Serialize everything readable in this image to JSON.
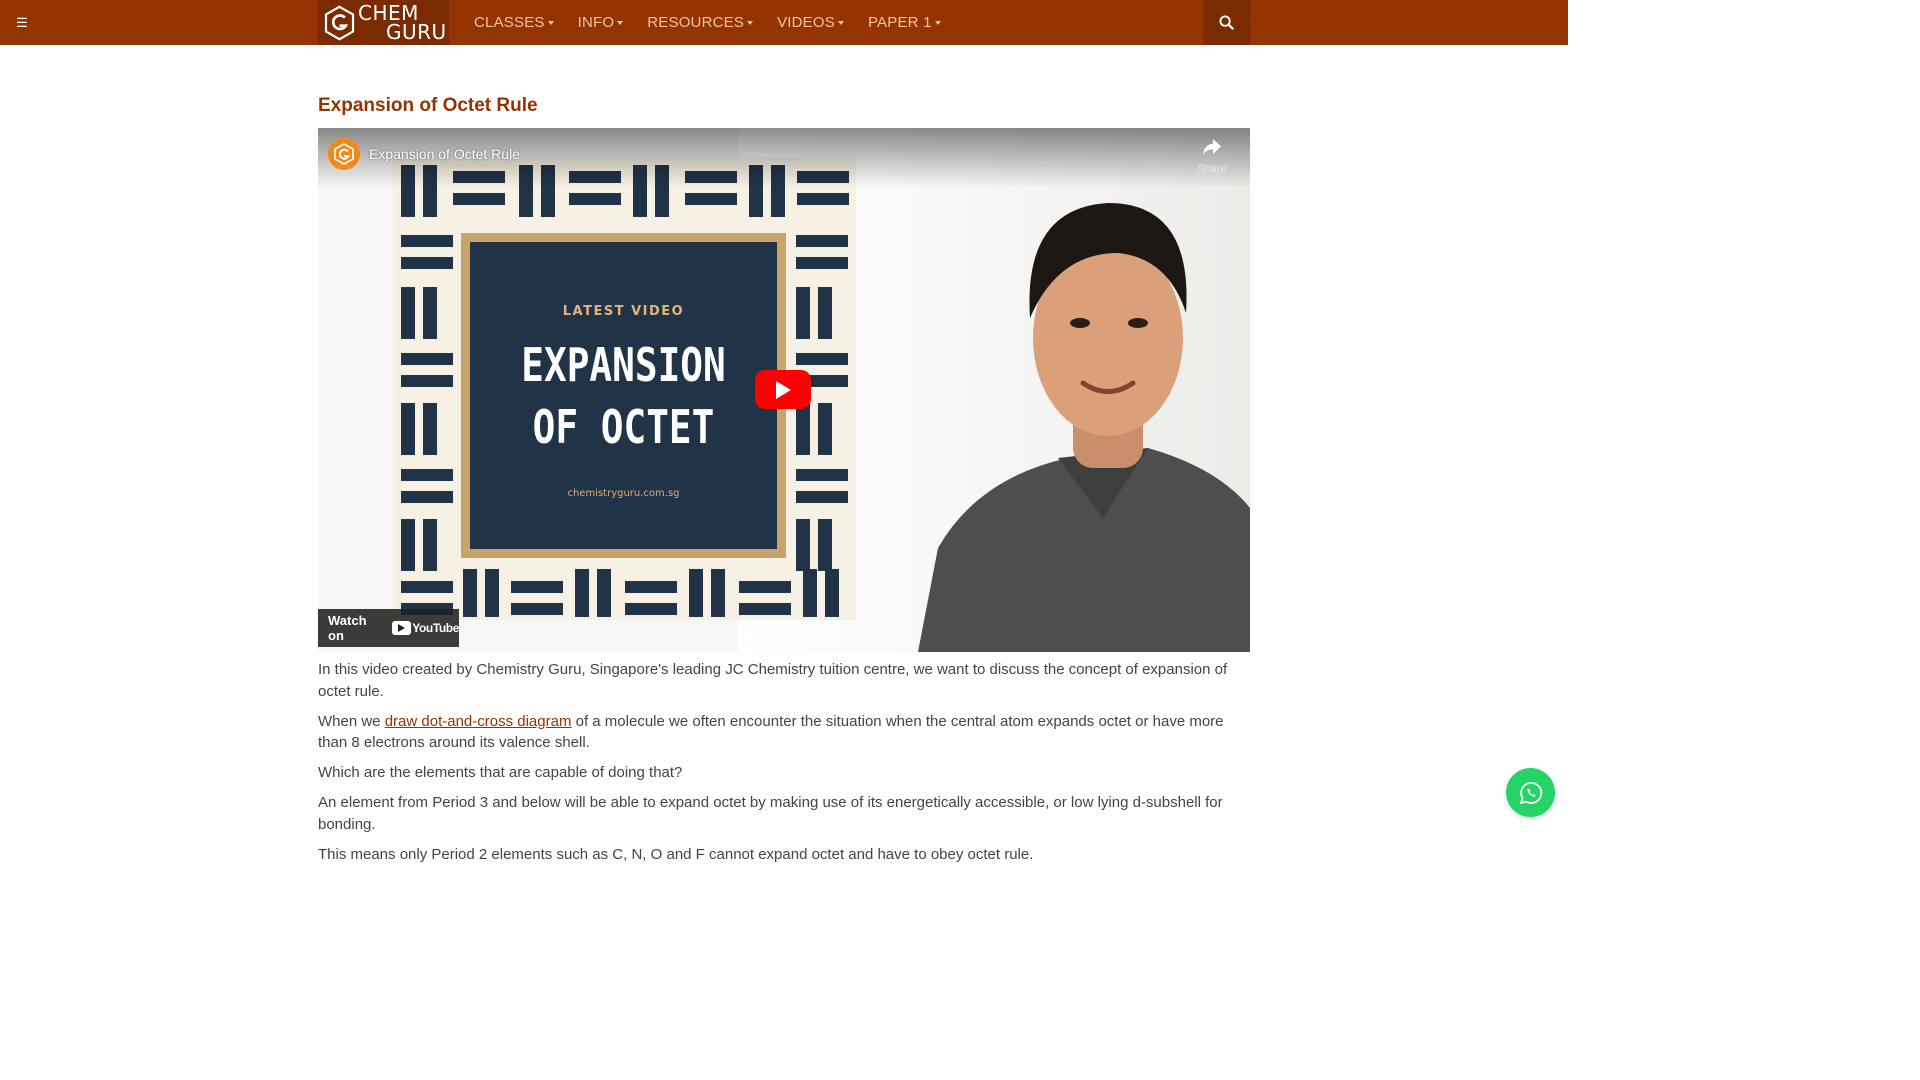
{
  "navbar": {
    "menu_icon": "hamburger-icon",
    "logo_line1": "CHEM",
    "logo_line2": "GURU",
    "items": [
      {
        "label": "CLASSES"
      },
      {
        "label": "INFO"
      },
      {
        "label": "RESOURCES"
      },
      {
        "label": "VIDEOS"
      },
      {
        "label": "PAPER 1"
      }
    ],
    "search_icon": "search-icon",
    "color": "#933402"
  },
  "page": {
    "title": "Expansion of Octet Rule"
  },
  "video": {
    "title": "Expansion of Octet Rule",
    "share_label": "Share",
    "watch_on_label": "Watch on",
    "youtube_label": "YouTube",
    "thumbnail": {
      "kicker": "LATEST VIDEO",
      "headline_line1": "EXPANSION",
      "headline_line2": "OF OCTET",
      "url": "chemistryguru.com.sg"
    },
    "play_color": "#ff0000"
  },
  "article": {
    "p1": "In this video created by Chemistry Guru, Singapore's leading JC Chemistry tuition centre, we want to discuss the concept of expansion of octet rule.",
    "p2_before": "When we ",
    "p2_link": "draw dot-and-cross diagram",
    "p2_after": " of a molecule we often encounter the situation when the central atom expands octet or have more than 8 electrons around its valence shell.",
    "p3": "Which are the elements that are capable of doing that?",
    "p4": "An element from Period 3 and below will be able to expand octet by making use of its energetically accessible, or low lying d-subshell for bonding.",
    "p5": "This means only Period 2 elements such as C, N, O and F cannot expand octet and have to obey octet rule."
  },
  "floating": {
    "whatsapp_icon": "whatsapp-icon",
    "color": "#25d366"
  }
}
